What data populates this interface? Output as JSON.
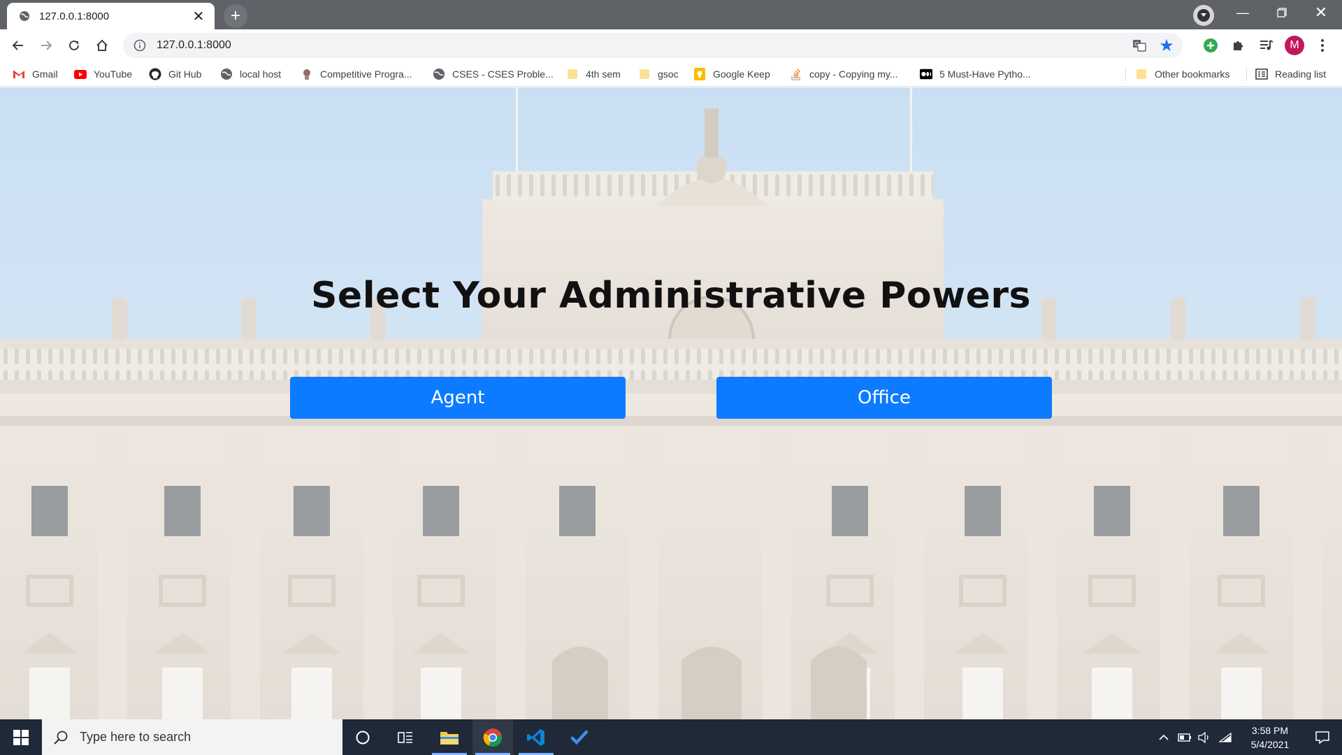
{
  "browser": {
    "tab_title": "127.0.0.1:8000",
    "url": "127.0.0.1:8000",
    "profile_initial": "M",
    "colors": {
      "tab_strip": "#5f6368",
      "profile_avatar": "#c2185b",
      "star": "#1a73e8"
    }
  },
  "bookmarks": {
    "items": [
      {
        "label": "Gmail",
        "icon": "gmail-icon"
      },
      {
        "label": "YouTube",
        "icon": "youtube-icon"
      },
      {
        "label": "Git Hub",
        "icon": "github-icon"
      },
      {
        "label": "local host",
        "icon": "globe-icon"
      },
      {
        "label": "Competitive Progra...",
        "icon": "site-icon"
      },
      {
        "label": "CSES - CSES Proble...",
        "icon": "globe-icon"
      },
      {
        "label": "4th sem",
        "icon": "folder-icon"
      },
      {
        "label": "gsoc",
        "icon": "folder-icon"
      },
      {
        "label": "Google Keep",
        "icon": "keep-icon"
      },
      {
        "label": "copy - Copying my...",
        "icon": "stackoverflow-icon"
      },
      {
        "label": "5 Must-Have Pytho...",
        "icon": "medium-icon"
      }
    ],
    "other_label": "Other bookmarks",
    "reading_list_label": "Reading list"
  },
  "page": {
    "heading": "Select Your Administrative Powers",
    "buttons": {
      "agent": "Agent",
      "office": "Office"
    },
    "button_color": "#0d7bff"
  },
  "taskbar": {
    "search_placeholder": "Type here to search",
    "time": "3:58 PM",
    "date": "5/4/2021"
  }
}
